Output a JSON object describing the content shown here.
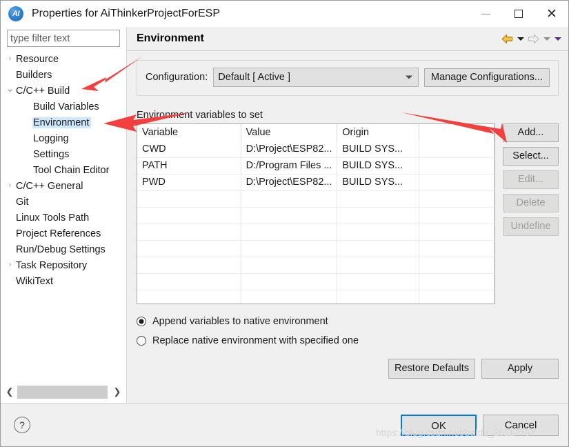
{
  "window": {
    "title": "Properties for AiThinkerProjectForESP",
    "app_icon": "ai-logo-icon",
    "minimize": "minimize-icon",
    "maximize": "maximize-icon",
    "close": "close-icon"
  },
  "filter": {
    "placeholder": "type filter text",
    "value": ""
  },
  "tree": {
    "items": [
      {
        "label": "Resource",
        "level": 1,
        "arrow": "collapsed",
        "selected": false
      },
      {
        "label": "Builders",
        "level": 1,
        "arrow": "none",
        "selected": false
      },
      {
        "label": "C/C++ Build",
        "level": 1,
        "arrow": "expanded",
        "selected": false
      },
      {
        "label": "Build Variables",
        "level": 2,
        "arrow": "none",
        "selected": false
      },
      {
        "label": "Environment",
        "level": 2,
        "arrow": "none",
        "selected": true
      },
      {
        "label": "Logging",
        "level": 2,
        "arrow": "none",
        "selected": false
      },
      {
        "label": "Settings",
        "level": 2,
        "arrow": "none",
        "selected": false
      },
      {
        "label": "Tool Chain Editor",
        "level": 2,
        "arrow": "none",
        "selected": false
      },
      {
        "label": "C/C++ General",
        "level": 1,
        "arrow": "collapsed",
        "selected": false
      },
      {
        "label": "Git",
        "level": 1,
        "arrow": "none",
        "selected": false
      },
      {
        "label": "Linux Tools Path",
        "level": 1,
        "arrow": "none",
        "selected": false
      },
      {
        "label": "Project References",
        "level": 1,
        "arrow": "none",
        "selected": false
      },
      {
        "label": "Run/Debug Settings",
        "level": 1,
        "arrow": "none",
        "selected": false
      },
      {
        "label": "Task Repository",
        "level": 1,
        "arrow": "collapsed",
        "selected": false
      },
      {
        "label": "WikiText",
        "level": 1,
        "arrow": "none",
        "selected": false
      }
    ],
    "scroll_left": "scroll-left-icon",
    "scroll_right": "scroll-right-icon"
  },
  "page": {
    "title": "Environment",
    "nav": {
      "back": "back-arrow-icon",
      "back_menu": "back-dropdown-icon",
      "forward": "forward-arrow-icon",
      "forward_menu": "forward-dropdown-icon",
      "view_menu": "view-menu-icon"
    },
    "configuration": {
      "label": "Configuration:",
      "value": "Default  [ Active ]",
      "manage_button": "Manage Configurations..."
    },
    "env_section": {
      "label": "Environment variables to set",
      "columns": [
        "Variable",
        "Value",
        "Origin",
        ""
      ],
      "rows": [
        {
          "variable": "CWD",
          "value": "D:\\Project\\ESP82...",
          "origin": "BUILD SYS...",
          "extra": ""
        },
        {
          "variable": "PATH",
          "value": "D:/Program Files ...",
          "origin": "BUILD SYS...",
          "extra": ""
        },
        {
          "variable": "PWD",
          "value": "D:\\Project\\ESP82...",
          "origin": "BUILD SYS...",
          "extra": ""
        }
      ],
      "empty_row_count": 7,
      "buttons": [
        {
          "label": "Add...",
          "enabled": true
        },
        {
          "label": "Select...",
          "enabled": true
        },
        {
          "label": "Edit...",
          "enabled": false
        },
        {
          "label": "Delete",
          "enabled": false
        },
        {
          "label": "Undefine",
          "enabled": false
        }
      ]
    },
    "radios": [
      {
        "label": "Append variables to native environment",
        "selected": true
      },
      {
        "label": "Replace native environment with specified one",
        "selected": false
      }
    ],
    "action_buttons": [
      {
        "label": "Restore Defaults"
      },
      {
        "label": "Apply"
      }
    ]
  },
  "footer": {
    "help": "help-icon",
    "ok": "OK",
    "cancel": "Cancel"
  },
  "watermark": "https://blog.csdn.net/baidu_25117757",
  "colors": {
    "selection": "#cde8ff",
    "accent": "#0078d7",
    "annotation_arrow": "#f43f3f",
    "nav_back": "#e8a317",
    "nav_view_menu": "#5b2a86"
  }
}
